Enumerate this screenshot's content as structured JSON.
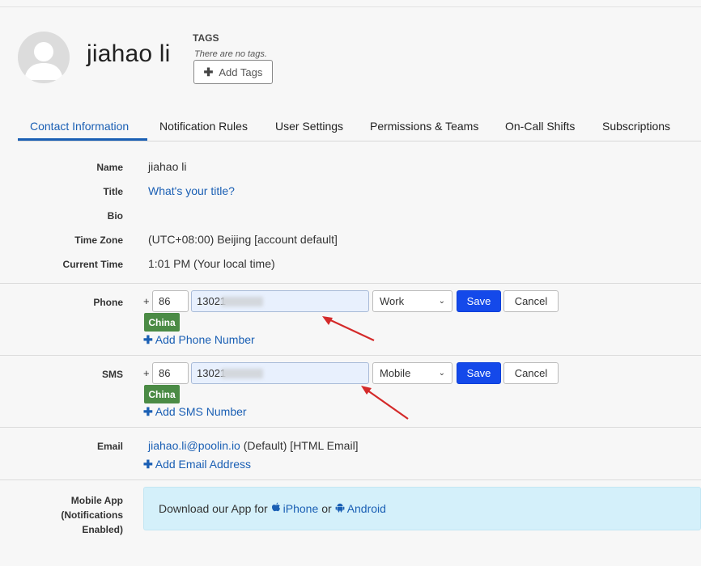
{
  "user": {
    "name": "jiahao li"
  },
  "tags": {
    "heading": "TAGS",
    "empty_text": "There are no tags.",
    "add_label": "Add Tags"
  },
  "tabs": [
    {
      "label": "Contact Information",
      "active": true
    },
    {
      "label": "Notification Rules",
      "active": false
    },
    {
      "label": "User Settings",
      "active": false
    },
    {
      "label": "Permissions & Teams",
      "active": false
    },
    {
      "label": "On-Call Shifts",
      "active": false
    },
    {
      "label": "Subscriptions",
      "active": false
    }
  ],
  "info": {
    "name_label": "Name",
    "name_value": "jiahao li",
    "title_label": "Title",
    "title_value": "What's your title?",
    "bio_label": "Bio",
    "bio_value": "",
    "timezone_label": "Time Zone",
    "timezone_value": "(UTC+08:00) Beijing [account default]",
    "current_time_label": "Current Time",
    "current_time_value": "1:01 PM (Your local time)"
  },
  "phone": {
    "label": "Phone",
    "plus": "+",
    "country_code": "86",
    "number": "13021",
    "type": "Work",
    "save_label": "Save",
    "cancel_label": "Cancel",
    "country": "China",
    "add_label": "Add Phone Number"
  },
  "sms": {
    "label": "SMS",
    "plus": "+",
    "country_code": "86",
    "number": "13021",
    "type": "Mobile",
    "save_label": "Save",
    "cancel_label": "Cancel",
    "country": "China",
    "add_label": "Add SMS Number"
  },
  "email": {
    "label": "Email",
    "address": "jiahao.li@poolin.io",
    "suffix": "(Default) [HTML Email]",
    "add_label": "Add Email Address"
  },
  "mobile_app": {
    "label_line1": "Mobile App",
    "label_line2": "(Notifications",
    "label_line3": "Enabled)",
    "text": "Download our App for",
    "iphone": "iPhone",
    "or": "or",
    "android": "Android"
  },
  "colors": {
    "accent": "#1a5fb4",
    "save": "#1449ea",
    "badge": "#4b8b45",
    "app_box": "#d4f0fa",
    "annotation": "#d42a2a"
  }
}
